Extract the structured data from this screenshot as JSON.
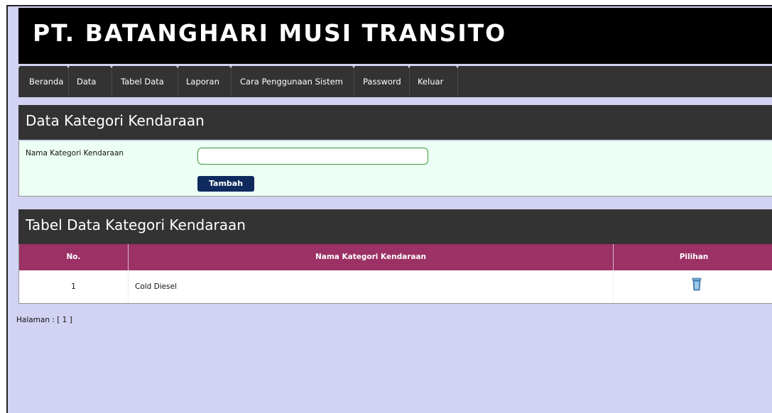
{
  "header": {
    "title": "PT. BATANGHARI MUSI TRANSITO"
  },
  "nav": {
    "items": [
      "Beranda",
      "Data",
      "Tabel Data",
      "Laporan",
      "Cara Penggunaan Sistem",
      "Password",
      "Keluar"
    ]
  },
  "form": {
    "heading": "Data Kategori Kendaraan",
    "field_label": "Nama Kategori Kendaraan",
    "field_value": "",
    "submit_label": "Tambah"
  },
  "table": {
    "heading": "Tabel Data Kategori Kendaraan",
    "columns": [
      "No.",
      "Nama Kategori Kendaraan",
      "Pilihan"
    ],
    "rows": [
      {
        "no": "1",
        "name": "Cold Diesel",
        "action_icon": "trash-icon"
      }
    ]
  },
  "pagination": {
    "text": "Halaman : [ 1 ]"
  },
  "colors": {
    "header_bg": "#000000",
    "nav_bg": "#333333",
    "table_header_bg": "#9b3165",
    "button_bg": "#0f2a5e",
    "page_bg": "#d2d2f2",
    "form_bg": "#ecfff4"
  }
}
